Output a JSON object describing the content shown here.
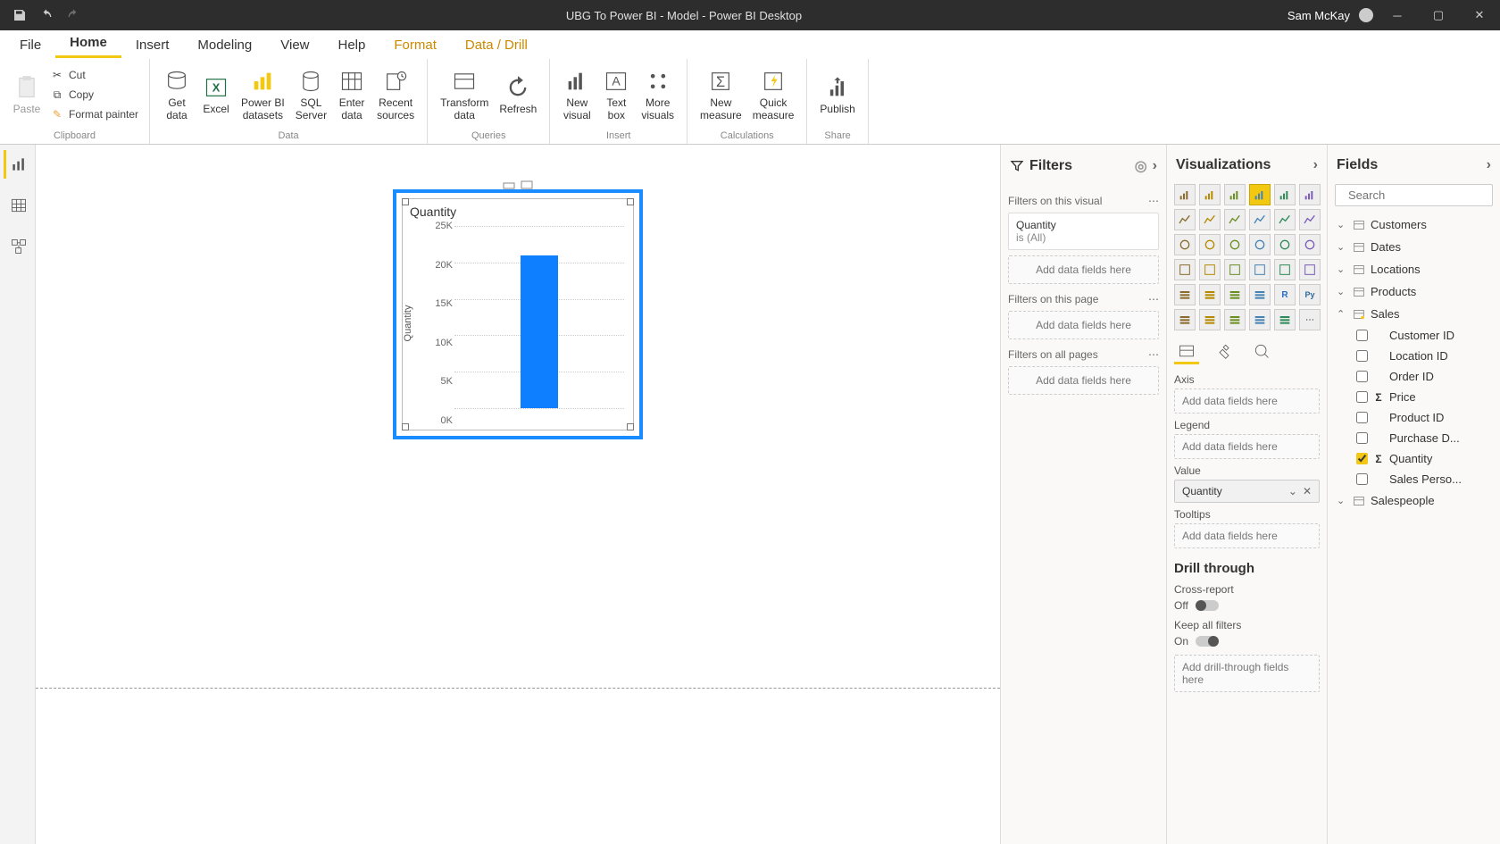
{
  "title_bar": {
    "title": "UBG To Power BI - Model - Power BI Desktop",
    "user_name": "Sam McKay"
  },
  "menu": {
    "file": "File",
    "home": "Home",
    "insert": "Insert",
    "modeling": "Modeling",
    "view": "View",
    "help": "Help",
    "format": "Format",
    "data_drill": "Data / Drill"
  },
  "ribbon": {
    "clipboard": {
      "label": "Clipboard",
      "paste": "Paste",
      "cut": "Cut",
      "copy": "Copy",
      "format_painter": "Format painter"
    },
    "data": {
      "label": "Data",
      "get_data": "Get\ndata",
      "excel": "Excel",
      "pbi_ds": "Power BI\ndatasets",
      "sql": "SQL\nServer",
      "enter": "Enter\ndata",
      "recent": "Recent\nsources"
    },
    "queries": {
      "label": "Queries",
      "transform": "Transform\ndata",
      "refresh": "Refresh"
    },
    "insert": {
      "label": "Insert",
      "new_visual": "New\nvisual",
      "text_box": "Text\nbox",
      "more": "More\nvisuals"
    },
    "calc": {
      "label": "Calculations",
      "new_measure": "New\nmeasure",
      "quick_measure": "Quick\nmeasure"
    },
    "share": {
      "label": "Share",
      "publish": "Publish"
    }
  },
  "filters": {
    "title": "Filters",
    "on_visual": "Filters on this visual",
    "quantity": "Quantity",
    "is_all": "is (All)",
    "add_fields": "Add data fields here",
    "on_page": "Filters on this page",
    "on_all": "Filters on all pages"
  },
  "viz": {
    "title": "Visualizations",
    "axis": "Axis",
    "add_fields": "Add data fields here",
    "legend": "Legend",
    "value": "Value",
    "value_field": "Quantity",
    "tooltips": "Tooltips",
    "drill": "Drill through",
    "cross_report": "Cross-report",
    "off": "Off",
    "keep_all": "Keep all filters",
    "on": "On",
    "add_drill": "Add drill-through fields here"
  },
  "fields": {
    "title": "Fields",
    "search_placeholder": "Search",
    "tables": {
      "customers": "Customers",
      "dates": "Dates",
      "locations": "Locations",
      "products": "Products",
      "sales": "Sales",
      "salespeople": "Salespeople"
    },
    "sales_fields": {
      "customer_id": "Customer ID",
      "location_id": "Location ID",
      "order_id": "Order ID",
      "price": "Price",
      "product_id": "Product ID",
      "purchase_d": "Purchase D...",
      "quantity": "Quantity",
      "sales_perso": "Sales Perso..."
    }
  },
  "chart_data": {
    "type": "bar",
    "title": "Quantity",
    "ylabel": "Quantity",
    "ylim": [
      0,
      25000
    ],
    "yticks_labels": [
      "0K",
      "5K",
      "10K",
      "15K",
      "20K",
      "25K"
    ],
    "yticks_values": [
      0,
      5000,
      10000,
      15000,
      20000,
      25000
    ],
    "categories": [
      ""
    ],
    "values": [
      21000
    ]
  }
}
